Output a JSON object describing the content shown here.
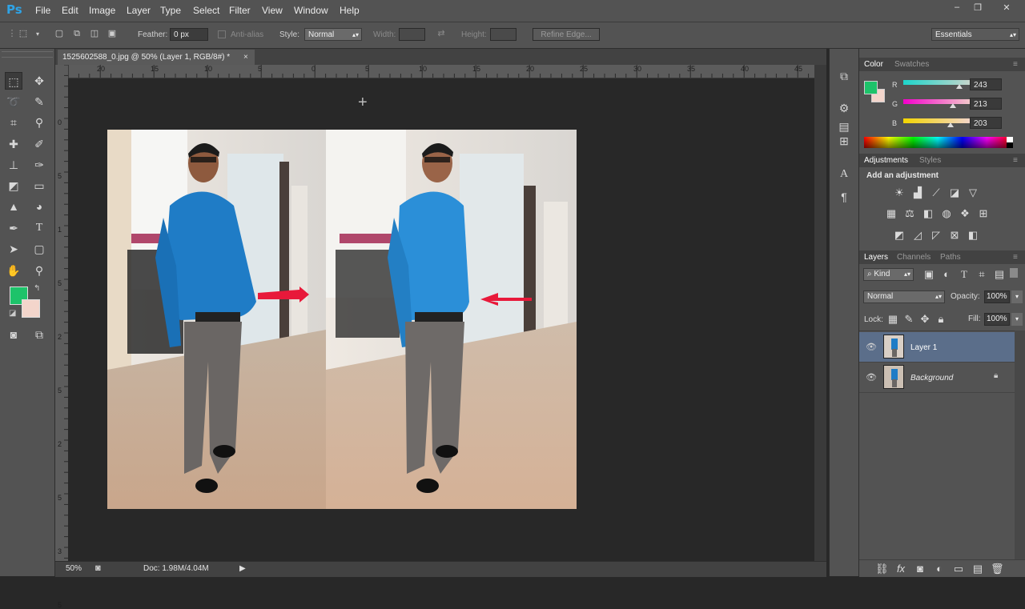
{
  "app": {
    "logo": "Ps",
    "menu": [
      "File",
      "Edit",
      "Image",
      "Layer",
      "Type",
      "Select",
      "Filter",
      "View",
      "Window",
      "Help"
    ],
    "window_controls": [
      "–",
      "❐",
      "✕"
    ]
  },
  "options": {
    "feather_label": "Feather:",
    "feather_value": "0 px",
    "antialias_label": "Anti-alias",
    "style_label": "Style:",
    "style_value": "Normal",
    "width_label": "Width:",
    "height_label": "Height:",
    "refine_edge": "Refine Edge...",
    "workspace": "Essentials"
  },
  "document": {
    "tab_title": "1525602588_0.jpg @ 50% (Layer 1, RGB/8#) *",
    "tab_close": "×",
    "ruler_h": [
      "20",
      "15",
      "10",
      "5",
      "0",
      "5",
      "10",
      "15",
      "20",
      "25",
      "30",
      "35",
      "40",
      "45"
    ],
    "ruler_v": [
      "0",
      "5",
      "1",
      "5",
      "2",
      "5",
      "2",
      "5",
      "3",
      "5"
    ],
    "zoom": "50%",
    "doc_info": "Doc: 1.98M/4.04M"
  },
  "color_panel": {
    "tabs": [
      "Color",
      "Swatches"
    ],
    "foreground": "#1dc36a",
    "background": "#f3d5cb",
    "channels": [
      {
        "label": "R",
        "value": "243",
        "fraction": 0.95,
        "gradient": "linear-gradient(to right,#1dd5cb,#f3d5cb)"
      },
      {
        "label": "G",
        "value": "213",
        "fraction": 0.84,
        "gradient": "linear-gradient(to right,#f300cb,#f3ffcb)"
      },
      {
        "label": "B",
        "value": "203",
        "fraction": 0.8,
        "gradient": "linear-gradient(to right,#f3d500,#f3d5ff)"
      }
    ]
  },
  "adjustments_panel": {
    "tabs": [
      "Adjustments",
      "Styles"
    ],
    "heading": "Add an adjustment",
    "row1": [
      "brightness-icon",
      "levels-icon",
      "curves-icon",
      "exposure-icon",
      "gradient-map-icon"
    ],
    "row2": [
      "vibrance-icon",
      "color-balance-icon",
      "black-white-icon",
      "photo-filter-icon",
      "channel-mixer-icon",
      "color-lookup-icon"
    ],
    "row3": [
      "invert-icon",
      "posterize-icon",
      "threshold-icon",
      "selective-color-icon",
      "gradient-fill-icon"
    ]
  },
  "layers_panel": {
    "tabs": [
      "Layers",
      "Channels",
      "Paths"
    ],
    "filter_kind": "Kind",
    "blend_mode": "Normal",
    "opacity_label": "Opacity:",
    "opacity_value": "100%",
    "lock_label": "Lock:",
    "fill_label": "Fill:",
    "fill_value": "100%",
    "layers": [
      {
        "name": "Layer 1",
        "selected": true,
        "locked": false
      },
      {
        "name": "Background",
        "selected": false,
        "locked": true
      }
    ]
  }
}
